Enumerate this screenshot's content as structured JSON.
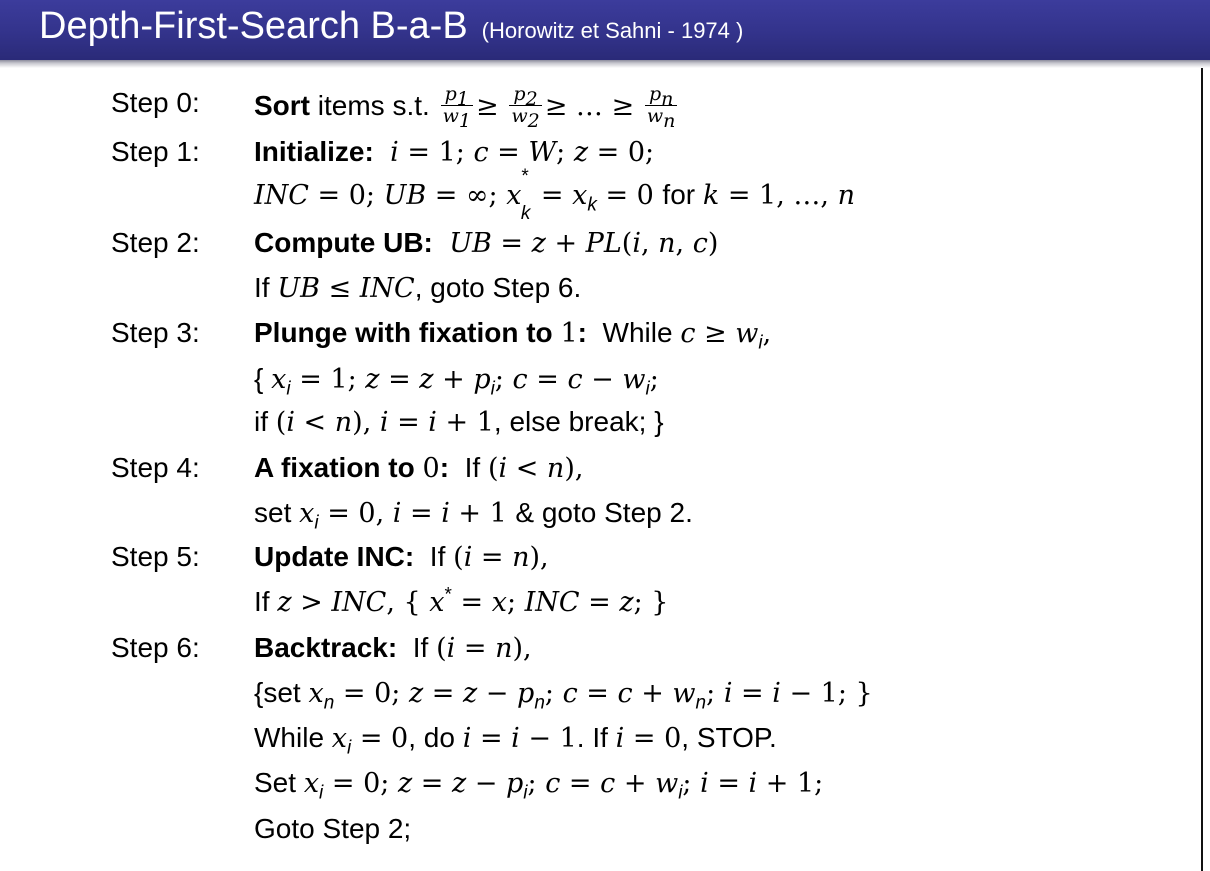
{
  "title": {
    "main": "Depth-First-Search B-a-B",
    "sub": "(Horowitz et Sahni - 1974 )"
  },
  "steps": [
    {
      "label": "Step 0:",
      "heading": "Sort"
    },
    {
      "label": "Step 1:",
      "heading": "Initialize:"
    },
    {
      "label": "Step 2:",
      "heading": "Compute UB:"
    },
    {
      "label": "Step 3:",
      "heading": "Plunge with fixation to"
    },
    {
      "label": "Step 4:",
      "heading": "A fixation to"
    },
    {
      "label": "Step 5:",
      "heading": "Update INC:"
    },
    {
      "label": "Step 6:",
      "heading": "Backtrack:"
    }
  ],
  "text": {
    "items_st": "items s.t.",
    "for_k": "for",
    "if_word": "If",
    "goto_step6": ", goto Step 6.",
    "while_word": "While",
    "else_break": ", else break; }",
    "if_lower": "if",
    "set_word": "set",
    "goto_step2_amp": "& goto Step 2.",
    "set_brace": "{set",
    "do_word": ", do",
    "if_i0": ". If",
    "stop": ", STOP.",
    "set_cap": "Set",
    "goto_step2_final": "Goto Step 2;"
  }
}
